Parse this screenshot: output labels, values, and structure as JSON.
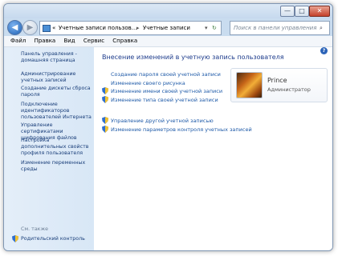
{
  "window": {
    "caption_minimize": "—",
    "caption_maximize": "□",
    "caption_close": "✕"
  },
  "nav": {
    "back_icon": "arrow-left-icon",
    "forward_icon": "arrow-right-icon",
    "breadcrumb_prefix": "«",
    "breadcrumb_1": "Учетные записи пользов...",
    "breadcrumb_sep": "▸",
    "breadcrumb_2": "Учетные записи пользователей",
    "search_placeholder": "Поиск в панели управления"
  },
  "menu": [
    "Файл",
    "Правка",
    "Вид",
    "Сервис",
    "Справка"
  ],
  "sidebar": {
    "items": [
      "Панель управления - домашняя страница",
      "Администрирование учетных записей",
      "Создание дискеты сброса пароля",
      "Подключение идентификаторов пользователей Интернета",
      "Управление сертификатами шифрования файлов",
      "Настройка дополнительных свойств профиля пользователя",
      "Изменение переменных среды"
    ],
    "see_also": "См. также",
    "parental_control": "Родительский контроль"
  },
  "main": {
    "heading": "Внесение изменений в учетную запись пользователя",
    "tasks": [
      "Создание пароля своей учетной записи",
      "Изменение своего рисунка",
      "Изменение имени своей учетной записи",
      "Изменение типа своей учетной записи"
    ],
    "other_tasks": [
      "Управление другой учетной записью",
      "Изменение параметров контроля учетных записей"
    ]
  },
  "user": {
    "name": "Prince",
    "role": "Администратор"
  },
  "colors": {
    "accent": "#1e5aa8",
    "heading": "#1e3c8c",
    "sidebar_bg": "#dde9f7"
  }
}
